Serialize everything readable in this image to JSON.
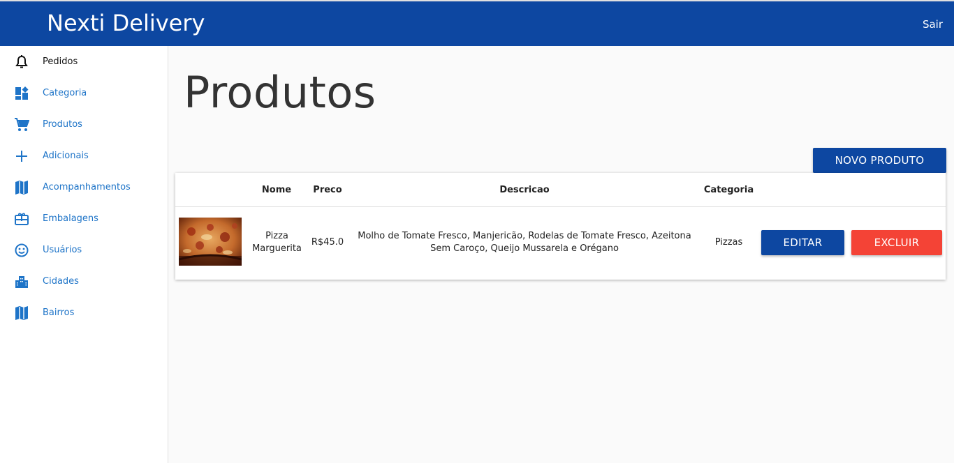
{
  "app": {
    "title": "Nexti Delivery",
    "logout_label": "Sair"
  },
  "sidebar": {
    "items": [
      {
        "label": "Pedidos",
        "icon": "bell-icon"
      },
      {
        "label": "Categoria",
        "icon": "dashboard-icon"
      },
      {
        "label": "Produtos",
        "icon": "cart-icon"
      },
      {
        "label": "Adicionais",
        "icon": "plus-icon"
      },
      {
        "label": "Acompanhamentos",
        "icon": "map-icon"
      },
      {
        "label": "Embalagens",
        "icon": "gift-card-icon"
      },
      {
        "label": "Usuários",
        "icon": "smiley-icon"
      },
      {
        "label": "Cidades",
        "icon": "city-icon"
      },
      {
        "label": "Bairros",
        "icon": "map-icon"
      }
    ]
  },
  "page": {
    "title": "Produtos",
    "new_button": "NOVO PRODUTO"
  },
  "table": {
    "headers": [
      "Nome",
      "Preco",
      "Descricao",
      "Categoria"
    ],
    "rows": [
      {
        "name": "Pizza Marguerita",
        "price": "R$45.0",
        "description": "Molho de Tomate Fresco, Manjericão, Rodelas de Tomate Fresco, Azeitona Sem Caroço, Queijo Mussarela e Orégano",
        "category": "Pizzas",
        "edit_label": "EDITAR",
        "delete_label": "EXCLUIR"
      }
    ]
  },
  "colors": {
    "primary": "#0d47a1",
    "danger": "#f44336",
    "nav_link": "#1e74c8"
  }
}
